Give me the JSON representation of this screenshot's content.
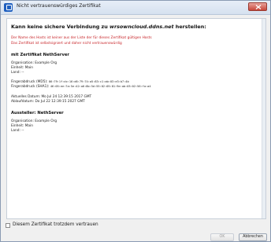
{
  "window": {
    "title": "Nicht vertrauenswürdiges Zertifikat"
  },
  "content": {
    "heading_prefix": "Kann keine sichere Verbindung zu ",
    "heading_host": "wrsowncloud.ddns.net",
    "heading_suffix": " herstellen:",
    "warning_lines": [
      "Der Name des Hosts ist keiner aus der Liste der für dieses Zertifikat gültigen Hosts",
      "Das Zertifikat ist selbstsigniert und daher nicht vertrauenswürdig"
    ],
    "cert_section_title": "mit Zertifikat NethServer",
    "cert_org": "Organisation: Example Org",
    "cert_unit": "Einheit: Main",
    "cert_country": "Land: --",
    "fingerprint_md5_label": "Fingerabdruck (MD5):",
    "fingerprint_md5_value": "86:79:1f:dc:16:d6:79:74:a5:83:c1:ab:03:e3:b7:4b",
    "fingerprint_sha1_label": "Fingerabdruck (SHA1):",
    "fingerprint_sha1_value": "46:05:ee:7a:5e:42:a0:8b:5d:55:02:05:01:9e:ab:03:02:56:fa:a4",
    "issue_date": "Aktuelles Datum: Mo Jul 24 12:39:15 2017 GMT",
    "expiry_date": "Ablaufdatum: Do Jul 22 12:39:15 2027 GMT",
    "issuer_section_title": "Aussteller: NethServer",
    "issuer_org": "Organisation: Example Org",
    "issuer_unit": "Einheit: Main",
    "issuer_country": "Land: --"
  },
  "footer": {
    "trust_checkbox_label": "Diesem Zertifikat trotzdem vertrauen",
    "ok_label": "OK",
    "cancel_label": "Abbrechen"
  },
  "colors": {
    "warning_text": "#c8262a",
    "close_button": "#c7463a"
  }
}
